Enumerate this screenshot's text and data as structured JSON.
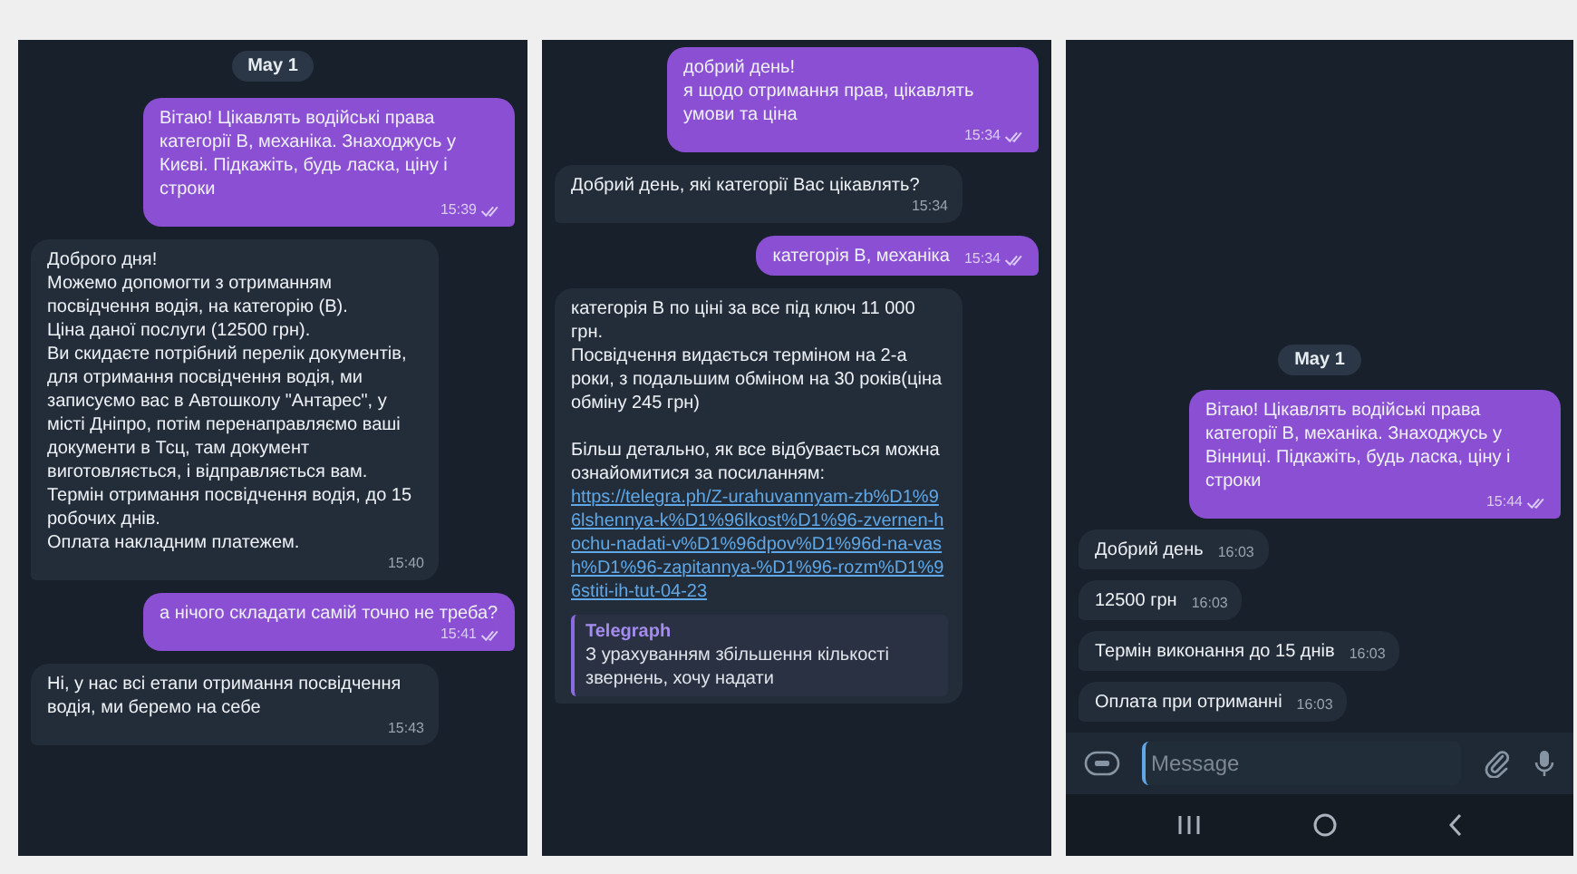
{
  "panels": [
    {
      "date": "May 1",
      "messages": [
        {
          "kind": "outgoing",
          "text": "Вітаю! Цікавлять водійські права категорії В, механіка. Знаходжусь у Києві. Підкажіть, будь ласка, ціну і строки",
          "time": "15:39",
          "read": true
        },
        {
          "kind": "incoming",
          "text": "Доброго дня!\nМожемо допомогти з отриманням посвідчення водія, на категорію (В).\nЦіна даної послуги (12500 грн).\n Ви скидаєте потрібний перелік документів, для отримання посвідчення водія, ми записуємо вас в Автошколу \"Антарес\", у місті Дніпро, потім перенаправляємо ваші документи в Тсц, там документ виготовляється, і відправляється вам.\nТермін отримання посвідчення водія, до 15 робочих днів.\nОплата накладним платежем.",
          "time": "15:40"
        },
        {
          "kind": "outgoing",
          "text": "а нічого складати самій точно не треба?",
          "time": "15:41",
          "read": true
        },
        {
          "kind": "incoming",
          "text": "Ні, у нас всі етапи отримання посвідчення водія, ми беремо на себе",
          "time": "15:43"
        }
      ]
    },
    {
      "messages": [
        {
          "kind": "outgoing",
          "text": "добрий день!\nя щодо отримання прав, цікавлять умови та ціна",
          "time": "15:34",
          "read": true
        },
        {
          "kind": "incoming",
          "text": "Добрий день, які категорії Вас цікавлять?",
          "time": "15:34"
        },
        {
          "kind": "outgoing",
          "text": "категорія В, механіка",
          "time": "15:34",
          "read": true
        },
        {
          "kind": "incoming",
          "text": "категорія В по ціні за все під ключ 11 000 грн.\nПосвідчення видається терміном на 2-а роки, з подальшим обміном на 30 років(ціна обміну 245 грн)\n\nБільш детально, як все відбувається можна ознайомитися за посиланням:",
          "link": "https://telegra.ph/Z-urahuvannyam-zb%D1%96lshennya-k%D1%96lkost%D1%96-zvernen-hochu-nadati-v%D1%96dpov%D1%96d-na-vash%D1%96-zapitannya-%D1%96-rozm%D1%96stiti-ih-tut-04-23",
          "preview": {
            "site": "Telegraph",
            "text": "З урахуванням збільшення кількості звернень, хочу надати"
          }
        }
      ]
    },
    {
      "date": "May 1",
      "messages": [
        {
          "kind": "outgoing",
          "text": "Вітаю! Цікавлять водійські права категорії В, механіка. Знаходжусь у Вінниці. Підкажіть, будь ласка, ціну і строки",
          "time": "15:44",
          "read": true
        },
        {
          "kind": "incoming",
          "text": "Добрий день",
          "time": "16:03"
        },
        {
          "kind": "incoming",
          "text": "12500 грн",
          "time": "16:03"
        },
        {
          "kind": "incoming",
          "text": "Термін виконання до 15 днів",
          "time": "16:03"
        },
        {
          "kind": "incoming",
          "text": "Оплата при отриманні",
          "time": "16:03"
        }
      ],
      "composer": {
        "placeholder": "Message"
      }
    }
  ]
}
